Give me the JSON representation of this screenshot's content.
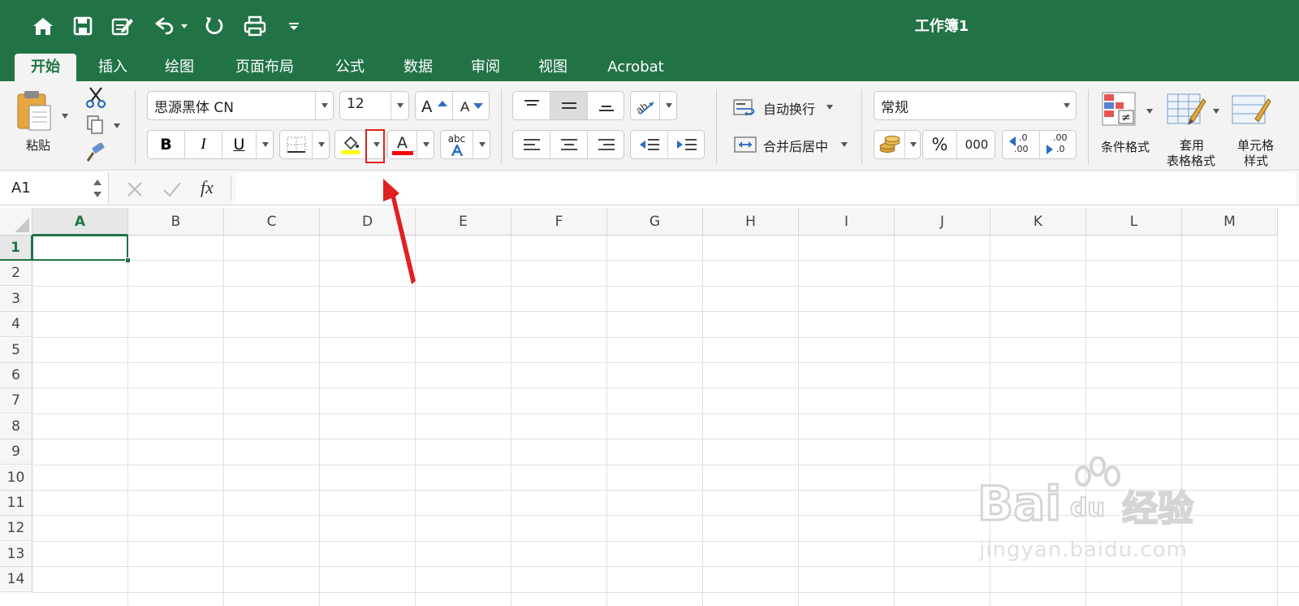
{
  "window": {
    "title": "工作簿1"
  },
  "tabs": [
    {
      "label": "开始",
      "active": true
    },
    {
      "label": "插入",
      "active": false
    },
    {
      "label": "绘图",
      "active": false
    },
    {
      "label": "页面布局",
      "active": false
    },
    {
      "label": "公式",
      "active": false
    },
    {
      "label": "数据",
      "active": false
    },
    {
      "label": "审阅",
      "active": false
    },
    {
      "label": "视图",
      "active": false
    },
    {
      "label": "Acrobat",
      "active": false
    }
  ],
  "ribbon": {
    "paste_label": "粘贴",
    "font_name": "思源黑体 CN",
    "font_size": "12",
    "bold_label": "B",
    "italic_label": "I",
    "underline_label": "U",
    "font_color_label": "A",
    "phonetic_label": "abc",
    "wrap_text_label": "自动换行",
    "merge_center_label": "合并后居中",
    "number_format": "常规",
    "percent_label": "%",
    "comma_label": "000",
    "increase_decimal_label": ".00",
    "decrease_decimal_label": ".00",
    "conditional_format_label": "条件格式",
    "table_format_label_1": "套用",
    "table_format_label_2": "表格格式",
    "cell_style_label_1": "单元格",
    "cell_style_label_2": "样式",
    "fill_color": "#ffff00",
    "font_color": "#ff0000"
  },
  "formula_bar": {
    "name_box": "A1",
    "fx_label": "fx",
    "formula": ""
  },
  "grid": {
    "columns": [
      "A",
      "B",
      "C",
      "D",
      "E",
      "F",
      "G",
      "H",
      "I",
      "J",
      "K",
      "L",
      "M"
    ],
    "rows": [
      "1",
      "2",
      "3",
      "4",
      "5",
      "6",
      "7",
      "8",
      "9",
      "10",
      "11",
      "12",
      "13",
      "14"
    ],
    "selected_cell": "A1"
  },
  "watermark": {
    "brand": "Bai",
    "brand_2": "du",
    "brand_3": "经验",
    "url": "jingyan.baidu.com"
  },
  "annotation": {
    "highlight_color": "#e02020"
  }
}
